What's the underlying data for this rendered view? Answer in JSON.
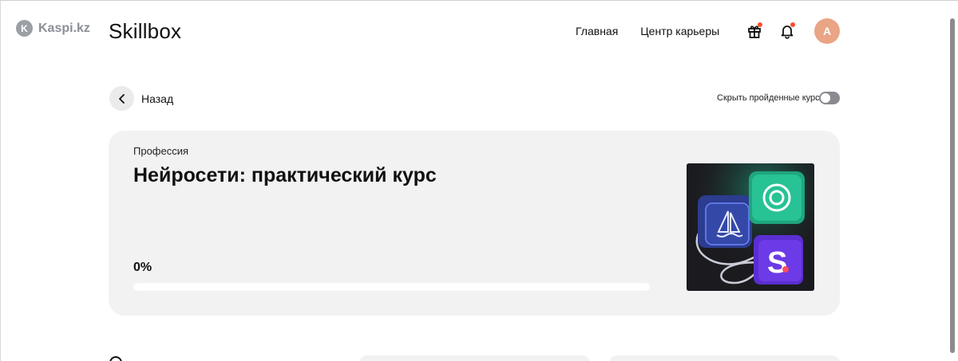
{
  "watermark": {
    "text": "Kaspi.kz"
  },
  "header": {
    "brand": "Skillbox",
    "nav": [
      {
        "label": "Главная"
      },
      {
        "label": "Центр карьеры"
      }
    ],
    "icons": {
      "gift": "gift-icon",
      "bell": "bell-icon"
    },
    "avatar_initial": "A"
  },
  "toolbar": {
    "back_label": "Назад",
    "hide_completed_label": "Скрыть пройденные курсы",
    "hide_completed_on": false
  },
  "course": {
    "kind": "Профессия",
    "title": "Нейросети: практический курс",
    "progress_text": "0%",
    "progress_value": 0
  },
  "colors": {
    "accent_avatar": "#e9a585",
    "notification_dot": "#ff4d2e",
    "card_bg": "#f2f2f3"
  }
}
